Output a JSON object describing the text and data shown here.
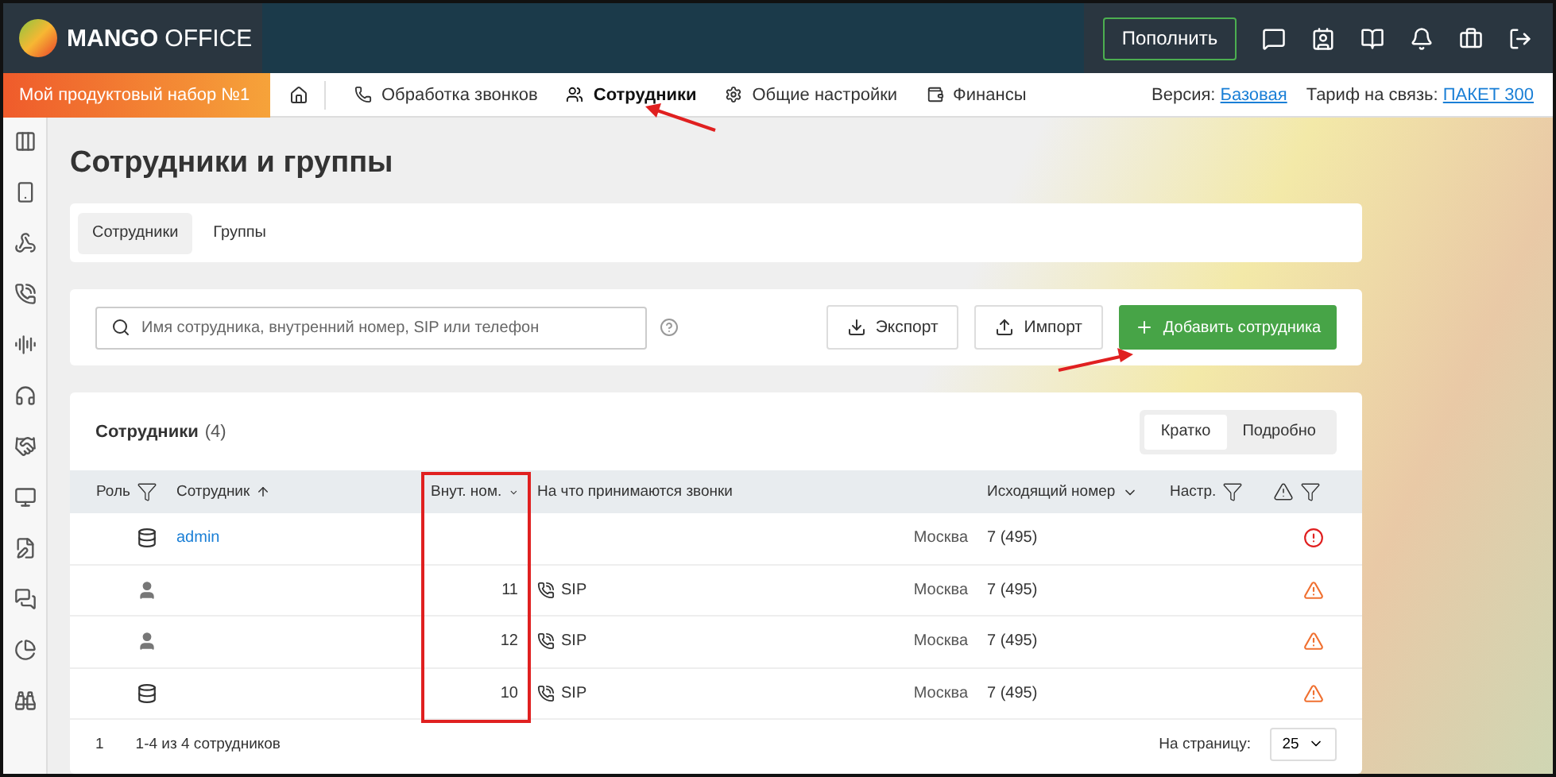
{
  "brand": {
    "name_bold": "MANGO",
    "name_light": "OFFICE"
  },
  "header": {
    "topup_button": "Пополнить"
  },
  "navbar": {
    "product_set": "Мой продуктовый набор №1",
    "items": [
      {
        "label": "Обработка звонков",
        "selected": false
      },
      {
        "label": "Сотрудники",
        "selected": true
      },
      {
        "label": "Общие настройки",
        "selected": false
      },
      {
        "label": "Финансы",
        "selected": false
      }
    ],
    "version_label": "Версия:",
    "version_value": "Базовая",
    "tariff_label": "Тариф на связь:",
    "tariff_value": "ПАКЕТ 300"
  },
  "page": {
    "title": "Сотрудники и группы"
  },
  "tabs": [
    {
      "label": "Сотрудники",
      "selected": true
    },
    {
      "label": "Группы",
      "selected": false
    }
  ],
  "search": {
    "placeholder": "Имя сотрудника, внутренний номер, SIP или телефон"
  },
  "actions": {
    "export": "Экспорт",
    "import": "Импорт",
    "add": "Добавить сотрудника"
  },
  "table": {
    "title": "Сотрудники",
    "count": "(4)",
    "view_modes": [
      {
        "label": "Кратко",
        "selected": true
      },
      {
        "label": "Подробно",
        "selected": false
      }
    ],
    "columns": [
      "Роль",
      "Сотрудник",
      "Внут. ном.",
      "На что принимаются звонки",
      "Исходящий номер",
      "Настр."
    ],
    "rows": [
      {
        "role": {
          "kind": "admin"
        },
        "name": "admin",
        "city": "Москва",
        "outgoing": "7 (495)",
        "alert": {
          "kind": "error"
        }
      },
      {
        "role": {
          "kind": "user"
        },
        "ext": "11",
        "route": "SIP",
        "city": "Москва",
        "outgoing": "7 (495)",
        "alert": {
          "kind": "warning"
        }
      },
      {
        "role": {
          "kind": "user"
        },
        "ext": "12",
        "route": "SIP",
        "city": "Москва",
        "outgoing": "7 (495)",
        "alert": {
          "kind": "warning"
        }
      },
      {
        "role": {
          "kind": "admin"
        },
        "ext": "10",
        "route": "SIP",
        "city": "Москва",
        "outgoing": "7 (495)",
        "alert": {
          "kind": "warning"
        }
      }
    ],
    "footer": {
      "page": "1",
      "summary": "1-4 из 4 сотрудников",
      "per_page_label": "На страницу:",
      "per_page_value": "25"
    }
  }
}
